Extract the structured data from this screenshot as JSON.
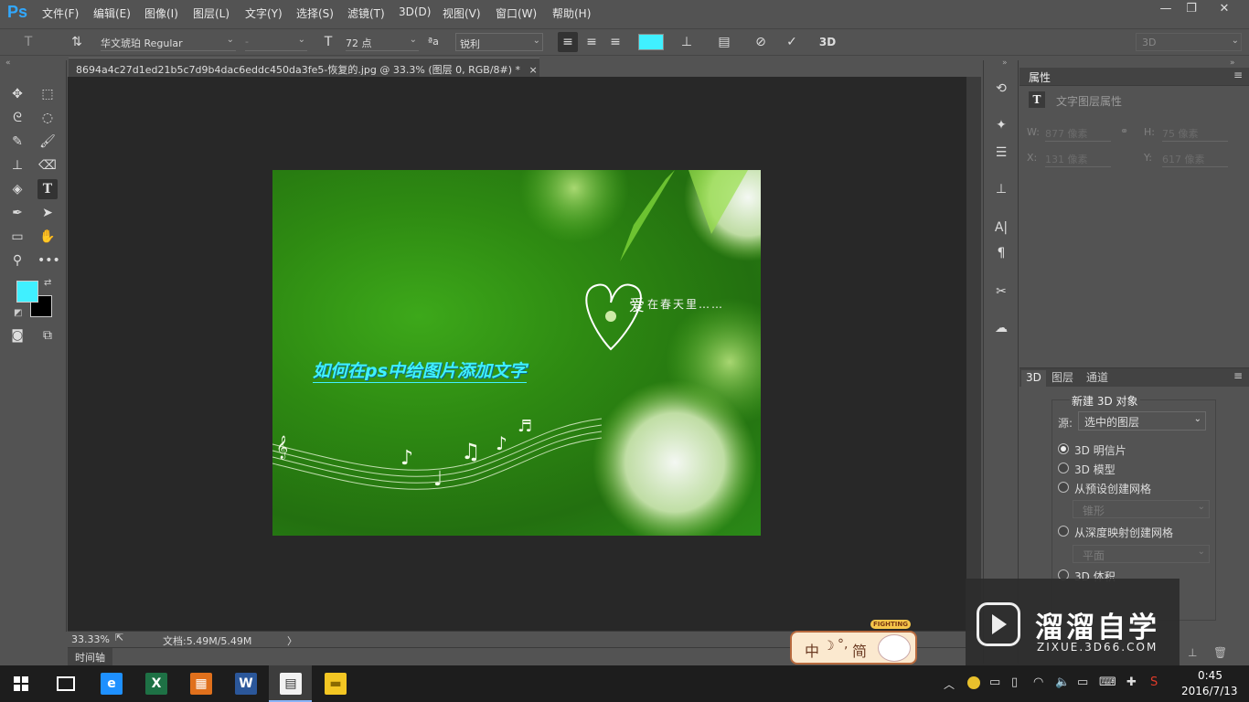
{
  "app": {
    "logo": "Ps",
    "accent": "#31a8ff"
  },
  "menu": [
    "文件(F)",
    "编辑(E)",
    "图像(I)",
    "图层(L)",
    "文字(Y)",
    "选择(S)",
    "滤镜(T)",
    "3D(D)",
    "视图(V)",
    "窗口(W)",
    "帮助(H)"
  ],
  "options": {
    "font_family": "华文琥珀 Regular",
    "font_style": "-",
    "font_size": "72 点",
    "aa_label": "ªa",
    "antialias": "锐利",
    "text_color": "#40f0ff",
    "label_3d": "3D",
    "workspace": "3D"
  },
  "document": {
    "tab_title": "8694a4c27d1ed21b5c7d9b4dac6eddc450da3fe5-恢复的.jpg @ 33.3% (图层 0, RGB/8#) *",
    "close_label": "×",
    "canvas_text": "如何在ps中给图片添加文字",
    "canvas_text_color": "#40f0ff",
    "photo_caption_big": "爱",
    "photo_caption": "在春天里……"
  },
  "status": {
    "zoom": "33.33%",
    "doc_size": "文档:5.49M/5.49M",
    "arrow": "〉"
  },
  "timeline": {
    "label": "时间轴"
  },
  "properties": {
    "tab": "属性",
    "subtitle": "文字图层属性",
    "w_label": "W:",
    "w_value": "877 像素",
    "h_label": "H:",
    "h_value": "75 像素",
    "x_label": "X:",
    "x_value": "131 像素",
    "y_label": "Y:",
    "y_value": "617 像素"
  },
  "panel3d": {
    "tabs": [
      "3D",
      "图层",
      "通道"
    ],
    "title": "新建 3D 对象",
    "source_label": "源:",
    "source_value": "选中的图层",
    "options": [
      {
        "label": "3D 明信片",
        "selected": true
      },
      {
        "label": "3D 模型",
        "selected": false
      },
      {
        "label": "从预设创建网格",
        "selected": false
      },
      {
        "label": "从深度映射创建网格",
        "selected": false
      },
      {
        "label": "3D 体积",
        "selected": false
      }
    ],
    "preset_value": "锥形",
    "depth_value": "平面"
  },
  "colors": {
    "foreground": "#40f0ff",
    "background": "#000000"
  },
  "watermark": {
    "title": "溜溜自学",
    "url": "ZIXUE.3D66.COM"
  },
  "ime": {
    "text": "中",
    "moon": "☽",
    "mid": "°,",
    "simp": "简",
    "badge": "FIGHTING"
  },
  "taskbar": {
    "time": "0:45",
    "date": "2016/7/13",
    "apps": [
      {
        "name": "edge",
        "glyph": "e",
        "color": "#1e90ff"
      },
      {
        "name": "excel",
        "glyph": "X",
        "color": "#1e7145"
      },
      {
        "name": "photos",
        "glyph": "▦",
        "color": "#e0701c"
      },
      {
        "name": "word",
        "glyph": "W",
        "color": "#2b579a"
      },
      {
        "name": "notepad",
        "glyph": "▤",
        "color": "#f2f2f2"
      },
      {
        "name": "explorer",
        "glyph": "▬",
        "color": "#f3c623"
      }
    ]
  }
}
